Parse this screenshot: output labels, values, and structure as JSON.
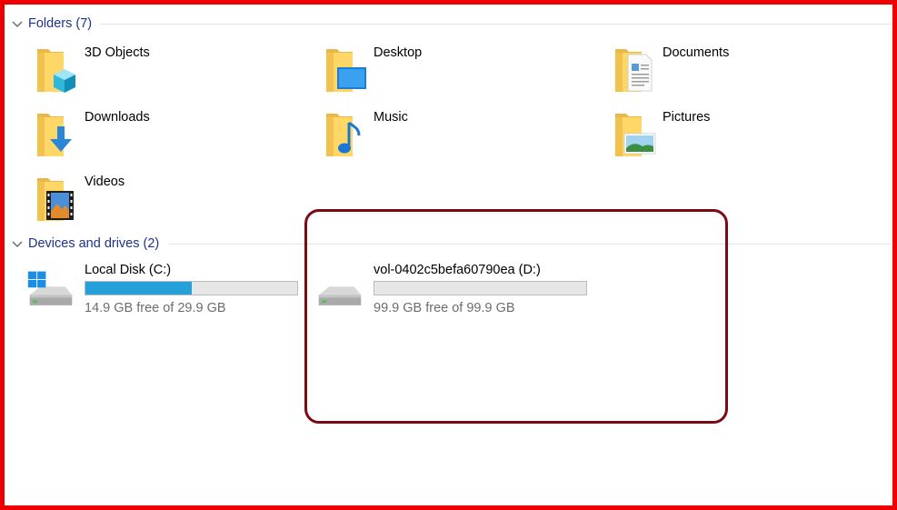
{
  "folders_group": {
    "title": "Folders (7)"
  },
  "folders": [
    {
      "label": "3D Objects",
      "icon": "3d-objects-folder-icon"
    },
    {
      "label": "Desktop",
      "icon": "desktop-folder-icon"
    },
    {
      "label": "Documents",
      "icon": "documents-folder-icon"
    },
    {
      "label": "Downloads",
      "icon": "downloads-folder-icon"
    },
    {
      "label": "Music",
      "icon": "music-folder-icon"
    },
    {
      "label": "Pictures",
      "icon": "pictures-folder-icon"
    },
    {
      "label": "Videos",
      "icon": "videos-folder-icon"
    }
  ],
  "devices_group": {
    "title": "Devices and drives (2)"
  },
  "drives": [
    {
      "label": "Local Disk (C:)",
      "free_text": "14.9 GB free of 29.9 GB",
      "used_fraction": 0.5,
      "icon": "windows-drive-icon"
    },
    {
      "label": "vol-0402c5befa60790ea (D:)",
      "free_text": "99.9 GB free of 99.9 GB",
      "used_fraction": 0.0,
      "icon": "hard-drive-icon"
    }
  ],
  "colors": {
    "frame": "#ee0000",
    "highlight": "#7a0a14",
    "group_title": "#1e3287",
    "usage_bar": "#26a0da"
  }
}
